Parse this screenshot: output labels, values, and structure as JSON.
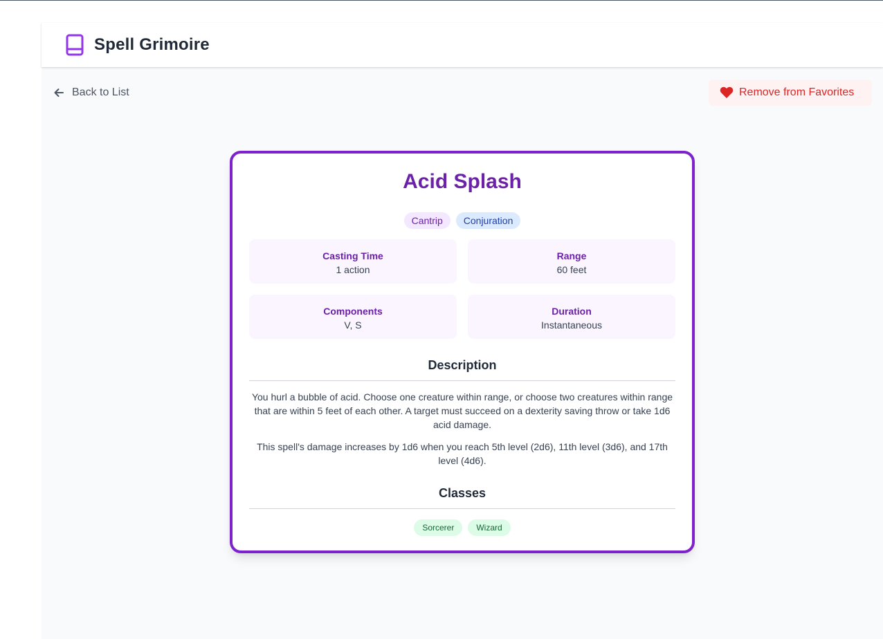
{
  "app": {
    "title": "Spell Grimoire",
    "logo_icon": "book-icon"
  },
  "nav": {
    "back_label": "Back to List",
    "back_icon": "arrow-left-icon",
    "favorite_label": "Remove from Favorites",
    "favorite_icon": "heart-icon"
  },
  "spell": {
    "name": "Acid Splash",
    "level_tag": "Cantrip",
    "school_tag": "Conjuration",
    "stats": [
      {
        "label": "Casting Time",
        "value": "1 action"
      },
      {
        "label": "Range",
        "value": "60 feet"
      },
      {
        "label": "Components",
        "value": "V, S"
      },
      {
        "label": "Duration",
        "value": "Instantaneous"
      }
    ],
    "description_title": "Description",
    "description": [
      "You hurl a bubble of acid. Choose one creature within range, or choose two creatures within range that are within 5 feet of each other. A target must succeed on a dexterity saving throw or take 1d6 acid damage.",
      "This spell's damage increases by 1d6 when you reach 5th level (2d6), 11th level (3d6), and 17th level (4d6)."
    ],
    "classes_title": "Classes",
    "classes": [
      "Sorcerer",
      "Wizard"
    ]
  },
  "colors": {
    "accent": "#7e22ce",
    "title": "#6b21a8",
    "favorite": "#dc2626",
    "class_tag_bg": "#dcfce7"
  }
}
